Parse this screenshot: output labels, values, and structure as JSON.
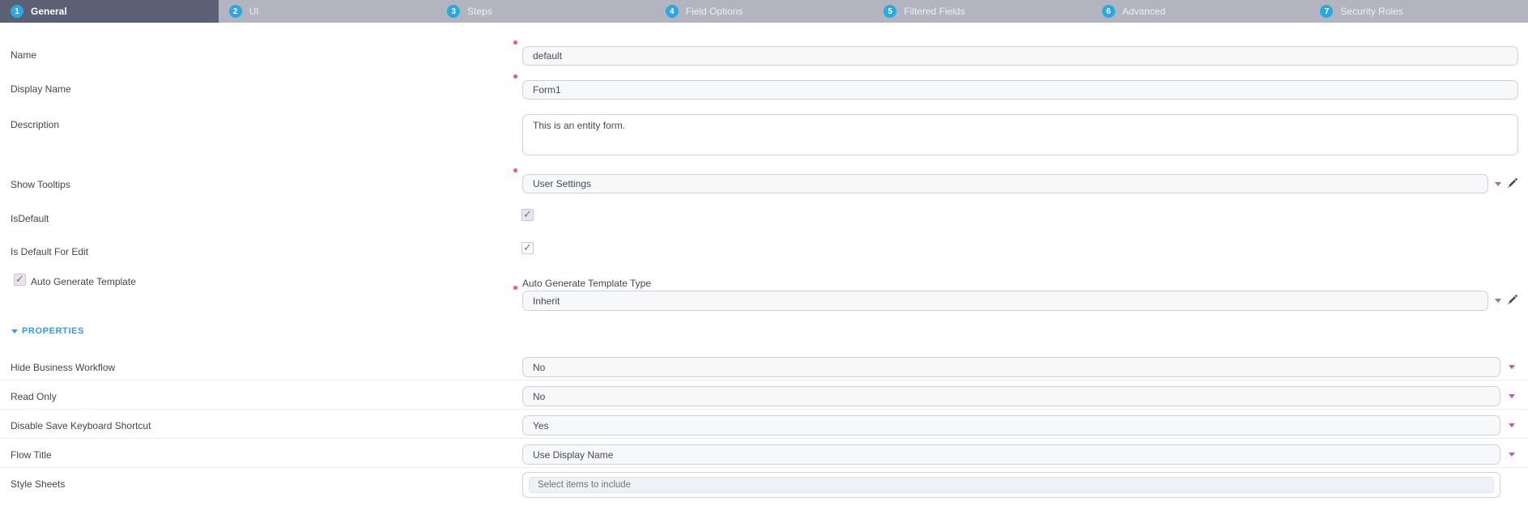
{
  "tabs": {
    "active_index": 0,
    "accent_circle_color": "#29a9e1",
    "active_bg": "#5b6074",
    "inactive_bg": "#b2b5c0",
    "items": [
      {
        "number": "1",
        "label": "General"
      },
      {
        "number": "2",
        "label": "UI"
      },
      {
        "number": "3",
        "label": "Steps"
      },
      {
        "number": "4",
        "label": "Field Options"
      },
      {
        "number": "5",
        "label": "Filtered Fields"
      },
      {
        "number": "6",
        "label": "Advanced"
      },
      {
        "number": "7",
        "label": "Security Roles"
      }
    ]
  },
  "form": {
    "name": {
      "label": "Name",
      "value": "default",
      "required": true
    },
    "display_name": {
      "label": "Display Name",
      "value": "Form1",
      "required": true
    },
    "description": {
      "label": "Description",
      "value": "This is an entity form."
    },
    "show_tooltips": {
      "label": "Show Tooltips",
      "value": "User Settings",
      "required": true
    },
    "is_default": {
      "label": "IsDefault",
      "checked": true,
      "disabled": true
    },
    "is_default_for_edit": {
      "label": "Is Default For Edit",
      "checked": true
    },
    "auto_generate_template": {
      "label": "Auto Generate Template",
      "checked": true
    },
    "auto_generate_template_type": {
      "label": "Auto Generate Template Type",
      "value": "Inherit",
      "required": true
    }
  },
  "properties": {
    "title": "PROPERTIES",
    "rows": [
      {
        "label": "Hide Business Workflow",
        "value": "No"
      },
      {
        "label": "Read Only",
        "value": "No"
      },
      {
        "label": "Disable Save Keyboard Shortcut",
        "value": "Yes"
      },
      {
        "label": "Flow Title",
        "value": "Use Display Name"
      }
    ],
    "style_sheets": {
      "label": "Style Sheets",
      "placeholder": "Select items to include"
    }
  },
  "icons": {
    "dropdown_caret": "caret-down",
    "edit_pencil": "pencil",
    "required_marker": "red-dot",
    "section_collapse": "caret-down"
  },
  "colors": {
    "required_dot": "#ef5e5e",
    "checkbox_check": "#a34fb5",
    "dropdown_caret": "#b55bc7",
    "section_title": "#2f9de4",
    "input_bg": "#f6f8fa",
    "input_border": "#ccd2da"
  }
}
